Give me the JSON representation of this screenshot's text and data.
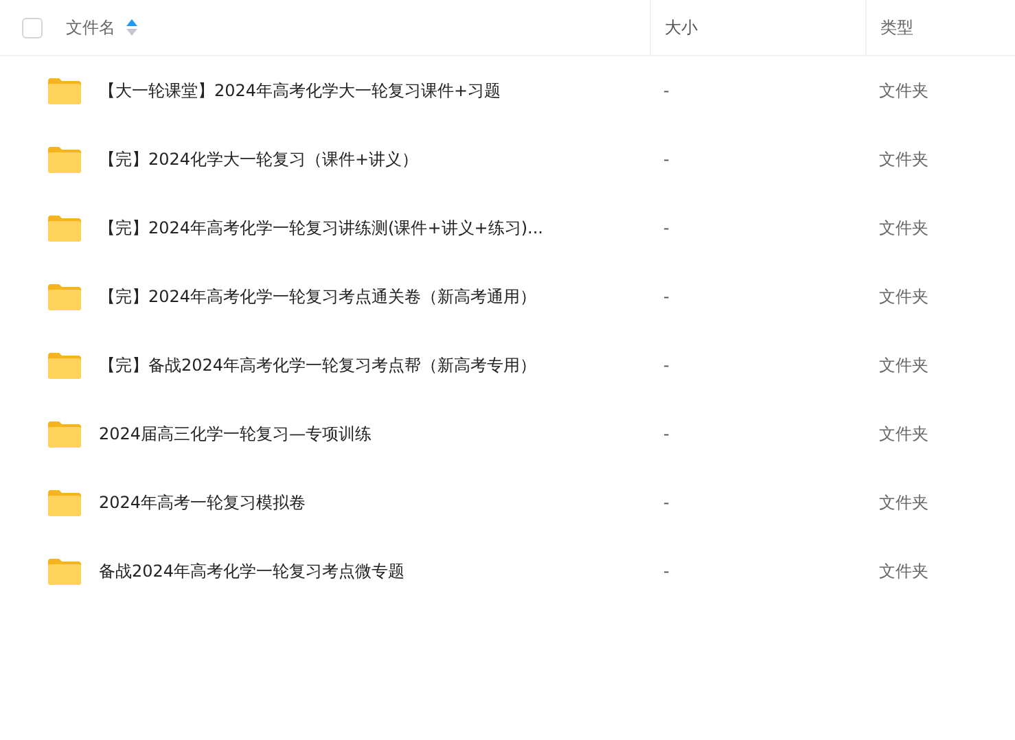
{
  "header": {
    "select_all": {
      "checked": false
    },
    "columns": [
      {
        "label": "文件名",
        "sorted_ascending": true
      },
      {
        "label": "大小"
      },
      {
        "label": "类型"
      }
    ]
  },
  "rows": [
    {
      "name": "【大一轮课堂】2024年高考化学大一轮复习课件+习题",
      "size": "-",
      "type": "文件夹"
    },
    {
      "name": "【完】2024化学大一轮复习（课件+讲义）",
      "size": "-",
      "type": "文件夹"
    },
    {
      "name": "【完】2024年高考化学一轮复习讲练测(课件+讲义+练习)...",
      "size": "-",
      "type": "文件夹"
    },
    {
      "name": "【完】2024年高考化学一轮复习考点通关卷（新高考通用）",
      "size": "-",
      "type": "文件夹"
    },
    {
      "name": "【完】备战2024年高考化学一轮复习考点帮（新高考专用）",
      "size": "-",
      "type": "文件夹"
    },
    {
      "name": "2024届高三化学一轮复习—专项训练",
      "size": "-",
      "type": "文件夹"
    },
    {
      "name": "2024年高考一轮复习模拟卷",
      "size": "-",
      "type": "文件夹"
    },
    {
      "name": "备战2024年高考化学一轮复习考点微专题",
      "size": "-",
      "type": "文件夹"
    }
  ]
}
